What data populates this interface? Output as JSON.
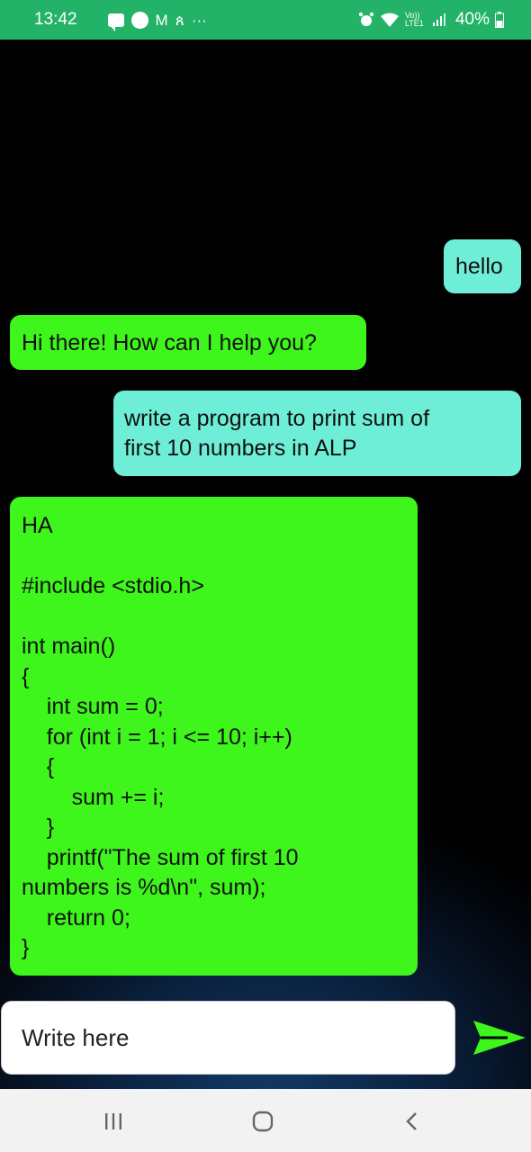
{
  "status_bar": {
    "time": "13:42",
    "left_icons": [
      "message-icon",
      "whatsapp-icon",
      "gmail-icon",
      "app-icon",
      "more-icon"
    ],
    "more_glyph": "···",
    "gmail_glyph": "M",
    "app_glyph": "ጰ",
    "network_label": "Vo)) LTE1",
    "battery": "40%",
    "background": "#23b368"
  },
  "chat": {
    "messages": [
      {
        "role": "user",
        "lines": [
          "hello"
        ]
      },
      {
        "role": "bot",
        "lines": [
          "Hi there! How can I help you?"
        ]
      },
      {
        "role": "user",
        "lines": [
          "write a program to print sum of",
          "first 10 numbers in ALP"
        ]
      },
      {
        "role": "bot",
        "lines": [
          "HA",
          "",
          "#include <stdio.h>",
          "",
          "int main()",
          "{",
          "    int sum = 0;",
          "    for (int i = 1; i <= 10; i++)",
          "    {",
          "        sum += i;",
          "    }",
          "    printf(\"The sum of first 10",
          "numbers is %d\\n\", sum);",
          "    return 0;",
          "}"
        ]
      }
    ],
    "user_bubble_color": "#6eeed6",
    "bot_bubble_color": "#3ef51c"
  },
  "input": {
    "placeholder": "Write here",
    "value": ""
  },
  "send_button": {
    "icon": "send-arrow-icon",
    "color": "#3ef51c"
  },
  "nav_bar": {
    "icons": [
      "recent-apps-icon",
      "home-icon",
      "back-icon"
    ]
  }
}
